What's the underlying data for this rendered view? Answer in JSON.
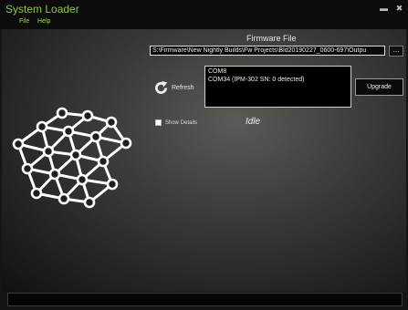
{
  "window": {
    "title": "System Loader",
    "controls": [
      "minimize-icon",
      "close-icon"
    ]
  },
  "menu": {
    "items": [
      "File",
      "Help"
    ]
  },
  "firmware": {
    "label": "Firmware File",
    "path": "S:\\Firmware\\New Nightly Builds\\Fw Projects\\Bld20190227_0600-697\\Outpu",
    "browse_label": "..."
  },
  "refresh": {
    "label": "Refresh",
    "icon": "refresh-icon"
  },
  "ports": [
    "COM8",
    "COM34  (IPM-302 SN: 0 detected)"
  ],
  "upgrade": {
    "label": "Upgrade"
  },
  "details": {
    "label": "Show Details",
    "checked": false
  },
  "status": {
    "text": "Idle"
  },
  "logo": {
    "icon": "network-lattice-logo"
  },
  "colors": {
    "title_green": "#8cc83c",
    "menu_green": "#a0d050",
    "background": "#3c3c3a"
  }
}
